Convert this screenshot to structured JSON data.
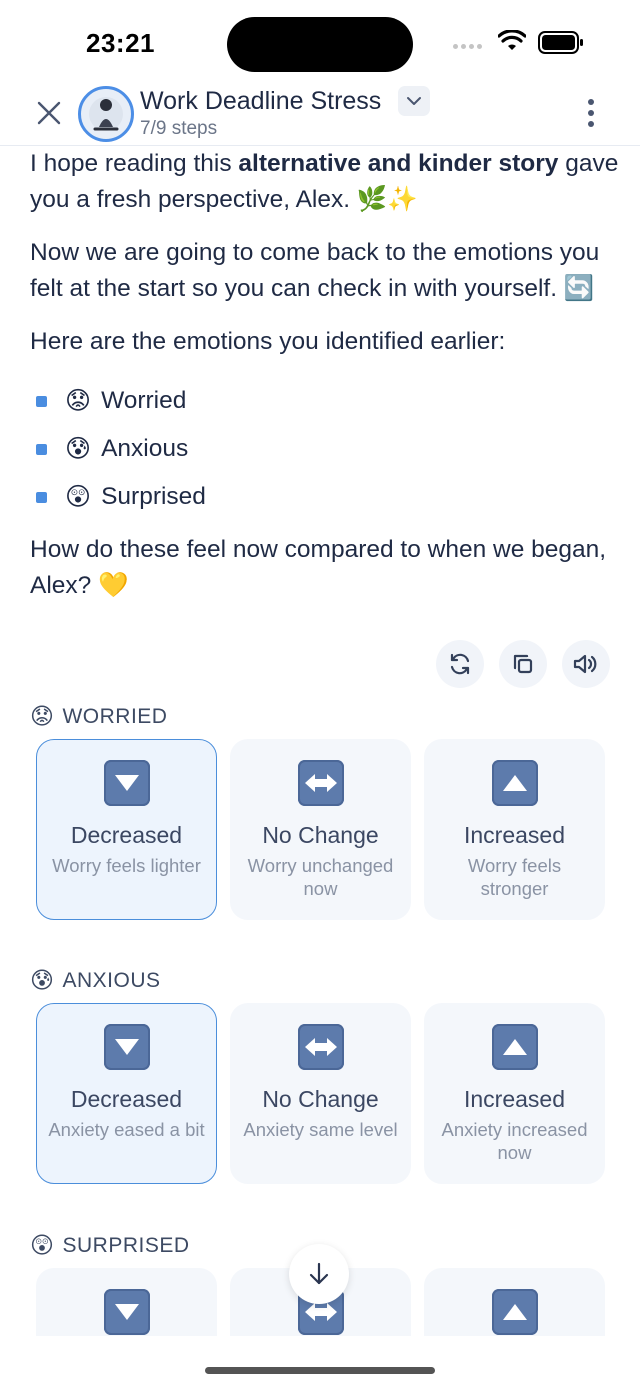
{
  "status": {
    "time": "23:21"
  },
  "header": {
    "title": "Work Deadline Stress",
    "steps": "7/9 steps"
  },
  "message": {
    "p1_before": "I hope reading this ",
    "p1_bold": "alternative and kinder story",
    "p1_after": " gave you a fresh perspective, Alex. 🌿✨",
    "p2": "Now we are going to come back to the emotions you felt at the start so you can check in with yourself. 🔄",
    "p3": "Here are the emotions you identified earlier:",
    "emotions": [
      {
        "emoji": "😟",
        "label": "Worried"
      },
      {
        "emoji": "😰",
        "label": "Anxious"
      },
      {
        "emoji": "😲",
        "label": "Surprised"
      }
    ],
    "p4": "How do these feel now compared to when we began, Alex? 💛"
  },
  "actions": {
    "icons": [
      "refresh-icon",
      "copy-icon",
      "speaker-icon"
    ]
  },
  "sections": [
    {
      "emoji": "😟",
      "label": "WORRIED",
      "selected": "Decreased",
      "options": [
        {
          "title": "Decreased",
          "sub": "Worry feels lighter",
          "icon": "down-arrow-icon"
        },
        {
          "title": "No Change",
          "sub": "Worry unchanged now",
          "icon": "left-right-arrow-icon"
        },
        {
          "title": "Increased",
          "sub": "Worry feels stronger",
          "icon": "up-arrow-icon"
        }
      ]
    },
    {
      "emoji": "😰",
      "label": "ANXIOUS",
      "selected": "Decreased",
      "options": [
        {
          "title": "Decreased",
          "sub": "Anxiety eased a bit",
          "icon": "down-arrow-icon"
        },
        {
          "title": "No Change",
          "sub": "Anxiety same level",
          "icon": "left-right-arrow-icon"
        },
        {
          "title": "Increased",
          "sub": "Anxiety increased now",
          "icon": "up-arrow-icon"
        }
      ]
    },
    {
      "emoji": "😲",
      "label": "SURPRISED"
    }
  ],
  "colors": {
    "accent": "#4b8edb",
    "option_icon": "#5d7bac",
    "text": "#1f2a44"
  }
}
